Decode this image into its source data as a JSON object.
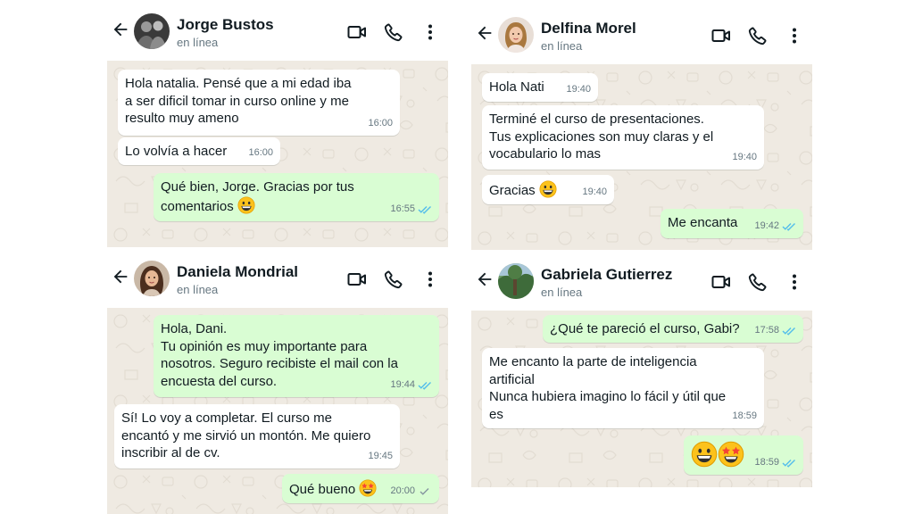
{
  "colors": {
    "chat_bg": "#efeae2",
    "incoming_bubble": "#ffffff",
    "outgoing_bubble": "#d9fdd3",
    "read_ticks": "#53bdeb",
    "sent_ticks": "#8696a0",
    "meta_text": "#667781"
  },
  "icons": [
    "back-arrow-icon",
    "video-call-icon",
    "phone-call-icon",
    "more-options-icon",
    "double-check-icon",
    "grinning-emoji-icon",
    "star-struck-emoji-icon"
  ],
  "chats": [
    {
      "contact": {
        "name": "Jorge Bustos",
        "status": "en línea"
      },
      "messages": [
        {
          "direction": "in",
          "text": "Hola natalia. Pensé que a mi edad iba\na ser dificil tomar in curso online y me\nresulto muy ameno",
          "time": "16:00"
        },
        {
          "direction": "in",
          "text": "Lo volvía a hacer",
          "time": "16:00"
        },
        {
          "direction": "out",
          "text": "Qué bien, Jorge. Gracias por tus\ncomentarios",
          "emoji": "grinning",
          "time": "16:55",
          "ticks": "read"
        }
      ]
    },
    {
      "contact": {
        "name": "Delfina Morel",
        "status": "en línea"
      },
      "messages": [
        {
          "direction": "in",
          "text": "Hola Nati",
          "time": "19:40"
        },
        {
          "direction": "in",
          "text": "Terminé el curso de presentaciones.\nTus explicaciones son muy claras y el\nvocabulario lo mas",
          "time": "19:40"
        },
        {
          "direction": "in",
          "text": "Gracias",
          "emoji": "grinning",
          "time": "19:40"
        },
        {
          "direction": "out",
          "text": "Me encanta",
          "time": "19:42",
          "ticks": "read"
        }
      ]
    },
    {
      "contact": {
        "name": "Daniela Mondrial",
        "status": "en línea"
      },
      "messages": [
        {
          "direction": "out",
          "text": "Hola, Dani.\nTu opinión es muy importante para\nnosotros.  Seguro recibiste el mail con la\nencuesta del curso.",
          "time": "19:44",
          "ticks": "read"
        },
        {
          "direction": "in",
          "text": "Sí! Lo voy a completar. El curso me\nencantó y me sirvió un montón. Me quiero\ninscribir al de cv.",
          "time": "19:45"
        },
        {
          "direction": "out",
          "text": "Qué bueno",
          "emoji": "star-struck",
          "time": "20:00",
          "ticks": "sent"
        }
      ]
    },
    {
      "contact": {
        "name": "Gabriela Gutierrez",
        "status": "en línea"
      },
      "messages": [
        {
          "direction": "out",
          "text": "¿Qué te pareció el curso, Gabi?",
          "time": "17:58",
          "ticks": "read"
        },
        {
          "direction": "in",
          "text": "Me encanto la parte de inteligencia\nartificial\nNunca hubiera imagino lo fácil y útil que\nes",
          "time": "18:59"
        },
        {
          "direction": "out",
          "text": "",
          "emoji": "grinning + star-struck",
          "time": "18:59",
          "ticks": "read"
        }
      ]
    }
  ]
}
